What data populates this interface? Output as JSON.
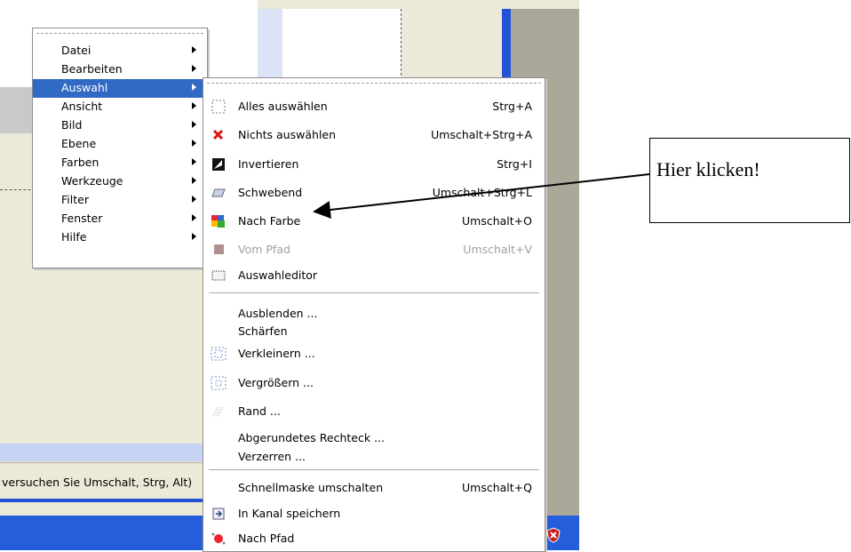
{
  "main_menu": {
    "items": [
      {
        "label": "Datei"
      },
      {
        "label": "Bearbeiten"
      },
      {
        "label": "Auswahl",
        "selected": true
      },
      {
        "label": "Ansicht"
      },
      {
        "label": "Bild"
      },
      {
        "label": "Ebene"
      },
      {
        "label": "Farben"
      },
      {
        "label": "Werkzeuge"
      },
      {
        "label": "Filter"
      },
      {
        "label": "Fenster"
      },
      {
        "label": "Hilfe"
      }
    ]
  },
  "submenu": {
    "items": [
      {
        "label": "Alles auswählen",
        "shortcut": "Strg+A",
        "icon": "select-all-icon"
      },
      {
        "label": "Nichts auswählen",
        "shortcut": "Umschalt+Strg+A",
        "icon": "select-none-icon"
      },
      {
        "label": "Invertieren",
        "shortcut": "Strg+I",
        "icon": "invert-icon"
      },
      {
        "label": "Schwebend",
        "shortcut": "Umschalt+Strg+L",
        "icon": "float-icon"
      },
      {
        "label": "Nach Farbe",
        "shortcut": "Umschalt+O",
        "icon": "by-color-icon"
      },
      {
        "label": "Vom Pfad",
        "shortcut": "Umschalt+V",
        "icon": "from-path-icon",
        "disabled": true
      },
      {
        "label": "Auswahleditor",
        "shortcut": "",
        "icon": "selection-editor-icon"
      },
      {
        "label": "Ausblenden ...",
        "shortcut": "",
        "icon": ""
      },
      {
        "label": "Schärfen",
        "shortcut": "",
        "icon": ""
      },
      {
        "label": "Verkleinern ...",
        "shortcut": "",
        "icon": "shrink-icon"
      },
      {
        "label": "Vergrößern ...",
        "shortcut": "",
        "icon": "grow-icon"
      },
      {
        "label": "Rand ...",
        "shortcut": "",
        "icon": "border-icon"
      },
      {
        "label": "Abgerundetes Rechteck ...",
        "shortcut": "",
        "icon": ""
      },
      {
        "label": "Verzerren ...",
        "shortcut": "",
        "icon": ""
      },
      {
        "label": "Schnellmaske umschalten",
        "shortcut": "Umschalt+Q",
        "icon": ""
      },
      {
        "label": "In Kanal speichern",
        "shortcut": "",
        "icon": "save-channel-icon"
      },
      {
        "label": "Nach Pfad",
        "shortcut": "",
        "icon": "to-path-icon"
      }
    ]
  },
  "statusbar": {
    "text": "versuchen Sie Umschalt, Strg, Alt)"
  },
  "callout": {
    "text": "Hier klicken!"
  },
  "colors": {
    "selection": "#316ac5",
    "taskbar": "#245edb",
    "window_bg": "#ece9d8"
  }
}
